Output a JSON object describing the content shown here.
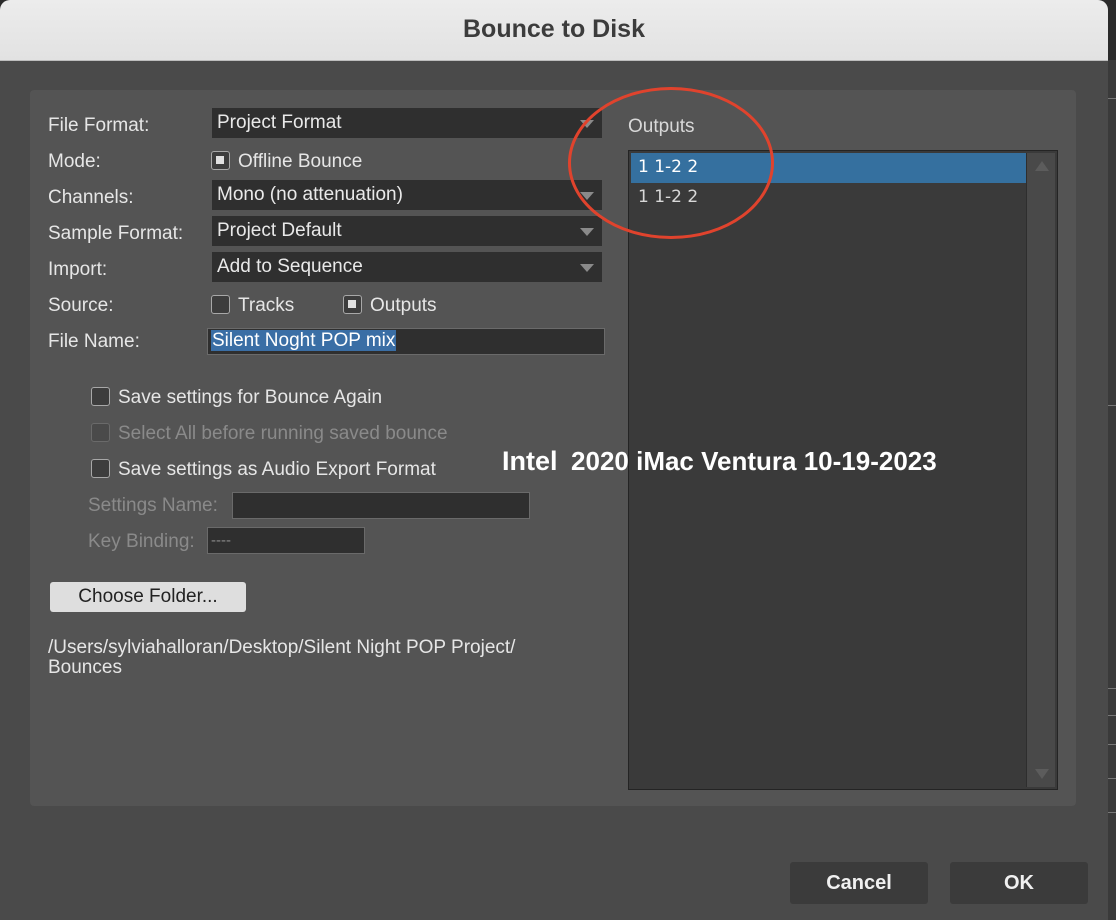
{
  "window": {
    "title": "Bounce to Disk"
  },
  "form": {
    "file_format": {
      "label": "File Format:",
      "value": "Project Format"
    },
    "mode": {
      "label": "Mode:",
      "option": "Offline Bounce",
      "checked": true
    },
    "channels": {
      "label": "Channels:",
      "value": "Mono (no attenuation)"
    },
    "sample_format": {
      "label": "Sample Format:",
      "value": "Project Default"
    },
    "import": {
      "label": "Import:",
      "value": "Add to Sequence"
    },
    "source": {
      "label": "Source:",
      "tracks": {
        "label": "Tracks",
        "checked": false
      },
      "outputs": {
        "label": "Outputs",
        "checked": true
      }
    },
    "file_name": {
      "label": "File Name:",
      "value": "Silent Noght POP mix"
    }
  },
  "options": {
    "save_bounce_again": {
      "label": "Save settings for Bounce Again",
      "checked": false
    },
    "select_all": {
      "label": "Select All before running saved bounce",
      "checked": false,
      "disabled": true
    },
    "save_audio_export": {
      "label": "Save settings as Audio Export Format",
      "checked": false
    },
    "settings_name": {
      "label": "Settings Name:",
      "value": ""
    },
    "key_binding": {
      "label": "Key Binding:",
      "value": "----"
    }
  },
  "folder": {
    "button_label": "Choose Folder...",
    "path_line1": "/Users/sylviahalloran/Desktop/Silent Night POP Project/",
    "path_line2": "Bounces"
  },
  "outputs": {
    "label": "Outputs",
    "items": [
      {
        "label": "1 1-2 2",
        "selected": true
      },
      {
        "label": "1 1-2 2",
        "selected": false
      }
    ]
  },
  "annotation": {
    "word1": "Intel",
    "rest": "2020 iMac Ventura 10-19-2023",
    "circle_color": "#e0432d"
  },
  "footer": {
    "cancel_label": "Cancel",
    "ok_label": "OK"
  },
  "colors": {
    "selection": "#35709f",
    "panel": "#545454",
    "background": "#4a4a4a"
  }
}
